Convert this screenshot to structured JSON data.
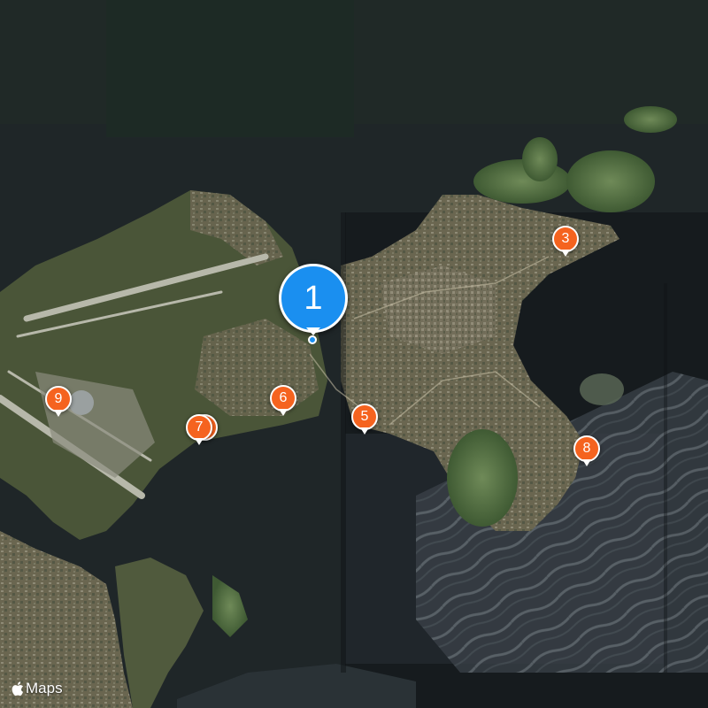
{
  "map": {
    "type": "satellite",
    "attribution": {
      "icon": "apple-logo-icon",
      "text": "Maps"
    },
    "colors": {
      "pin_orange": "#f5631f",
      "pin_blue": "#1a8ff0"
    },
    "markers": [
      {
        "id": "marker-1",
        "label": "1",
        "style": "selected"
      },
      {
        "id": "marker-3",
        "label": "3",
        "style": "default"
      },
      {
        "id": "marker-5",
        "label": "5",
        "style": "default"
      },
      {
        "id": "marker-6",
        "label": "6",
        "style": "default"
      },
      {
        "id": "marker-7",
        "label": "7",
        "style": "stacked"
      },
      {
        "id": "marker-8",
        "label": "8",
        "style": "default"
      },
      {
        "id": "marker-9",
        "label": "9",
        "style": "default"
      }
    ]
  }
}
